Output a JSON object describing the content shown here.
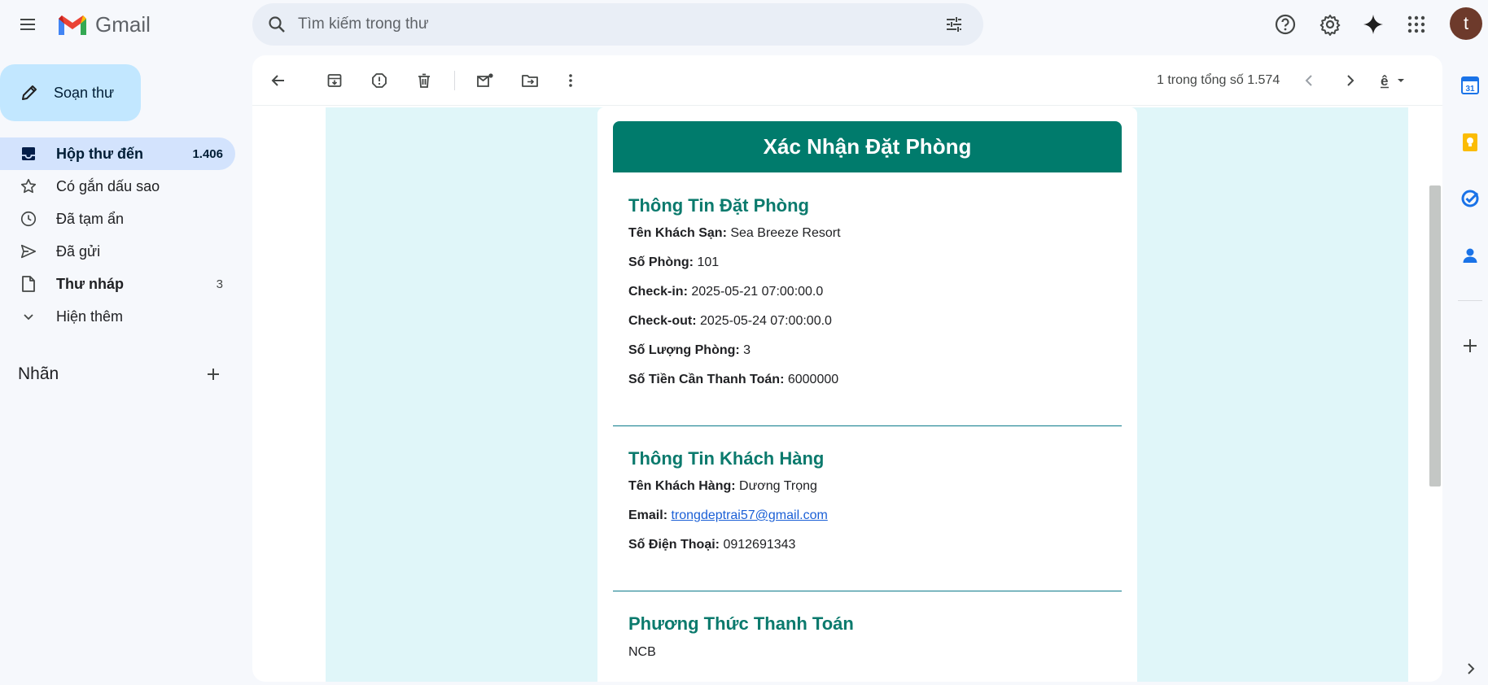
{
  "app": {
    "logo_text": "Gmail",
    "accent": "#0b57d0",
    "compose_bg": "#c2e7ff"
  },
  "search": {
    "placeholder": "Tìm kiếm trong thư"
  },
  "user": {
    "avatar_letter": "t",
    "avatar_color": "#6d3a2b"
  },
  "compose": {
    "label": "Soạn thư"
  },
  "sidebar": {
    "items": [
      {
        "label": "Hộp thư đến",
        "count": "1.406",
        "icon": "inbox-icon"
      },
      {
        "label": "Có gắn dấu sao",
        "count": "",
        "icon": "star-icon"
      },
      {
        "label": "Đã tạm ẩn",
        "count": "",
        "icon": "clock-icon"
      },
      {
        "label": "Đã gửi",
        "count": "",
        "icon": "send-icon"
      },
      {
        "label": "Thư nháp",
        "count": "3",
        "icon": "draft-icon"
      },
      {
        "label": "Hiện thêm",
        "count": "",
        "icon": "chevron-down-icon"
      }
    ],
    "labels_heading": "Nhãn"
  },
  "toolbar": {
    "pager": "1 trong tổng số 1.574"
  },
  "email": {
    "header_title": "Xác Nhận Đặt Phòng",
    "header_color": "#007b6c",
    "booking": {
      "title": "Thông Tin Đặt Phòng",
      "rows": [
        {
          "label": "Tên Khách Sạn:",
          "value": "Sea Breeze Resort"
        },
        {
          "label": "Số Phòng:",
          "value": "101"
        },
        {
          "label": "Check-in:",
          "value": "2025-05-21 07:00:00.0"
        },
        {
          "label": "Check-out:",
          "value": "2025-05-24 07:00:00.0"
        },
        {
          "label": "Số Lượng Phòng:",
          "value": "3"
        },
        {
          "label": "Số Tiền Cần Thanh Toán:",
          "value": "6000000"
        }
      ]
    },
    "customer": {
      "title": "Thông Tin Khách Hàng",
      "name_label": "Tên Khách Hàng:",
      "name_value": "Dương Trọng",
      "email_label": "Email:",
      "email_value": "trongdeptrai57@gmail.com",
      "phone_label": "Số Điện Thoại:",
      "phone_value": "0912691343"
    },
    "payment": {
      "title": "Phương Thức Thanh Toán",
      "value": "NCB"
    }
  }
}
